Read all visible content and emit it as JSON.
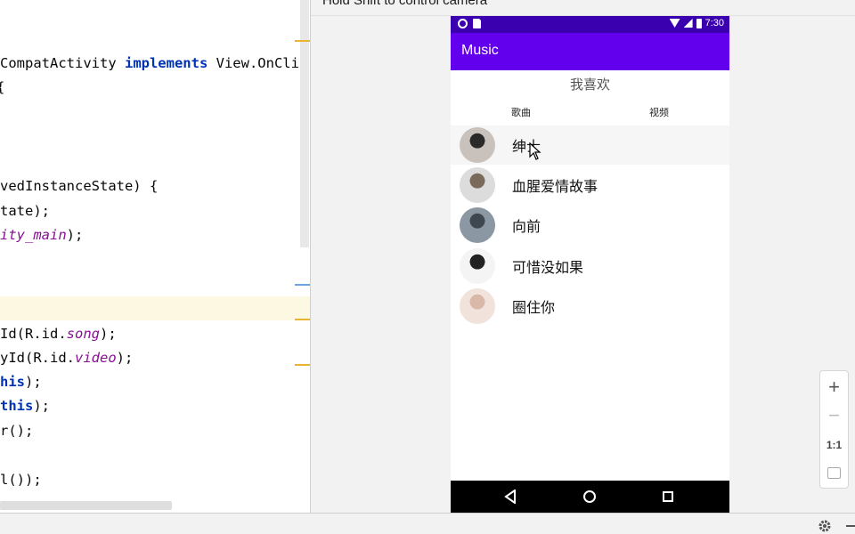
{
  "editor": {
    "lines": [
      {
        "segments": [
          {
            "t": "CompatActivity ",
            "c": ""
          },
          {
            "t": "implements",
            "c": "kw"
          },
          {
            "t": " View.OnCli",
            "c": ""
          }
        ]
      },
      {
        "segments": [
          {
            "t": "{",
            "c": ""
          }
        ]
      },
      {
        "segments": [
          {
            "t": "vedInstanceState) {",
            "c": ""
          }
        ]
      },
      {
        "segments": [
          {
            "t": "tate);",
            "c": ""
          }
        ]
      },
      {
        "segments": [
          {
            "t": "ity_main",
            "c": "it"
          },
          {
            "t": ");",
            "c": ""
          }
        ]
      },
      {
        "segments": [
          {
            "t": "Id(R.id.",
            "c": ""
          },
          {
            "t": "song",
            "c": "it"
          },
          {
            "t": ");",
            "c": ""
          }
        ]
      },
      {
        "segments": [
          {
            "t": "yId(R.id.",
            "c": ""
          },
          {
            "t": "video",
            "c": "it"
          },
          {
            "t": ");",
            "c": ""
          }
        ]
      },
      {
        "segments": [
          {
            "t": "his",
            "c": "kw"
          },
          {
            "t": ");",
            "c": ""
          }
        ]
      },
      {
        "segments": [
          {
            "t": "this",
            "c": "kw"
          },
          {
            "t": ");",
            "c": ""
          }
        ]
      },
      {
        "segments": [
          {
            "t": "r();",
            "c": ""
          }
        ]
      },
      {
        "segments": [
          {
            "t": "l());",
            "c": ""
          }
        ]
      }
    ]
  },
  "emulator": {
    "hint": "Hold Shift to control camera",
    "status_time": "7:30",
    "app_title": "Music",
    "page_title": "我喜欢",
    "tabs": {
      "song": "歌曲",
      "video": "视频"
    },
    "songs": [
      {
        "name": "绅士",
        "avatar_colors": [
          "#c9c2bc",
          "#2a2a2a"
        ]
      },
      {
        "name": "血腥爱情故事",
        "avatar_colors": [
          "#dcdcdc",
          "#7a6a5a"
        ]
      },
      {
        "name": "向前",
        "avatar_colors": [
          "#8b98a4",
          "#3e4650"
        ]
      },
      {
        "name": "可惜没如果",
        "avatar_colors": [
          "#f4f4f4",
          "#222222"
        ]
      },
      {
        "name": "圈住你",
        "avatar_colors": [
          "#f1e3dc",
          "#d9b8aa"
        ]
      }
    ],
    "colors": {
      "status_bar": "#3a00b0",
      "app_bar": "#6200ee",
      "nav_bar": "#000000"
    }
  },
  "zoom": {
    "zoom_in": "+",
    "zoom_out": "−",
    "actual_size": "1:1"
  }
}
